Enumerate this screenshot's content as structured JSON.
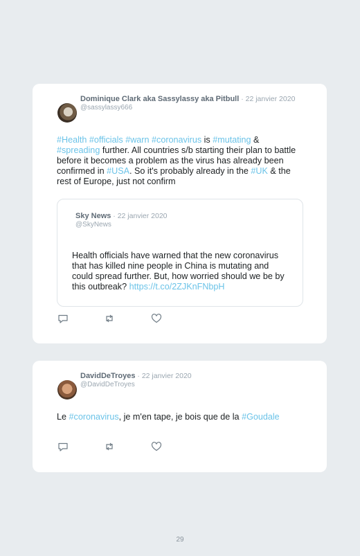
{
  "tweets": [
    {
      "author": "Dominique Clark aka Sassylassy aka Pitbull",
      "date": " · 22 janvier 2020",
      "handle": "@sassylassy666",
      "text": [
        {
          "t": "#Health",
          "tag": true
        },
        {
          "t": " ",
          "tag": false
        },
        {
          "t": "#officials",
          "tag": true
        },
        {
          "t": " ",
          "tag": false
        },
        {
          "t": "#warn",
          "tag": true
        },
        {
          "t": " ",
          "tag": false
        },
        {
          "t": "#coronavirus",
          "tag": true
        },
        {
          "t": " is ",
          "tag": false
        },
        {
          "t": "#mutating",
          "tag": true
        },
        {
          "t": " & ",
          "tag": false
        },
        {
          "t": "#spreading",
          "tag": true
        },
        {
          "t": " further. All countries s/b starting their plan to battle before it becomes a problem as the virus has already been confirmed in ",
          "tag": false
        },
        {
          "t": "#USA",
          "tag": true
        },
        {
          "t": ". So it's probably already in the ",
          "tag": false
        },
        {
          "t": "#UK",
          "tag": true
        },
        {
          "t": " & the rest of Europe, just not confirm",
          "tag": false
        }
      ],
      "quote": {
        "author": "Sky News",
        "date": " · 22 janvier 2020",
        "handle": "@SkyNews",
        "text": "Health officials have warned that the new coronavirus that has killed nine people in China is mutating and could spread further. But, how worried should we be by this outbreak?",
        "link": "https://t.co/2ZJKnFNbpH"
      }
    },
    {
      "author": "DavidDeTroyes",
      "date": " · 22 janvier 2020",
      "handle": "@DavidDeTroyes",
      "text": [
        {
          "t": "Le ",
          "tag": false
        },
        {
          "t": "#coronavirus",
          "tag": true
        },
        {
          "t": ", je m'en tape, je bois que de la ",
          "tag": false
        },
        {
          "t": "#Goudale",
          "tag": true
        }
      ]
    }
  ],
  "page_number": "29",
  "colors": {
    "hashtag": "#6bc3e8",
    "background": "#e8ecef",
    "card": "#ffffff"
  },
  "icons": [
    "reply-icon",
    "retweet-icon",
    "like-icon"
  ]
}
